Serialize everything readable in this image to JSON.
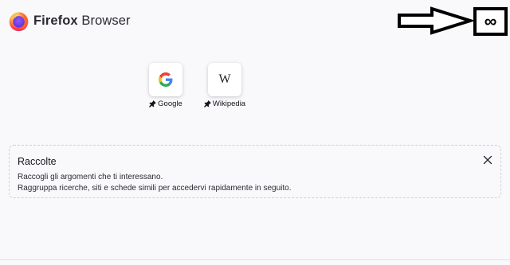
{
  "header": {
    "brand_bold": "Firefox",
    "brand_rest": " Browser",
    "menu_glyph": "∞"
  },
  "top_sites": [
    {
      "label": "Google",
      "icon": "google-g-icon"
    },
    {
      "label": "Wikipedia",
      "icon": "wikipedia-w-icon",
      "glyph": "W"
    }
  ],
  "collections": {
    "title": "Raccolte",
    "line1": "Raccogli gli argomenti che ti interessano.",
    "line2": "Raggruppa ricerche, siti e schede simili per accedervi rapidamente in seguito."
  },
  "colors": {
    "background": "#f9f9fb",
    "google_blue": "#4285F4",
    "google_red": "#EA4335",
    "google_yellow": "#FBBC05",
    "google_green": "#34A853",
    "firefox_orange": "#ff7139",
    "firefox_purple": "#7542e5"
  }
}
